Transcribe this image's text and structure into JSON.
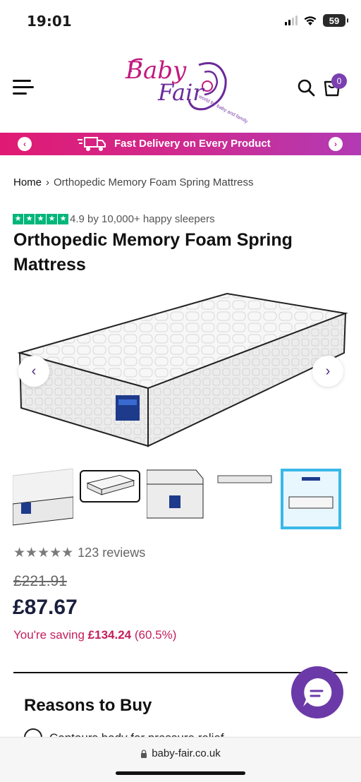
{
  "status_bar": {
    "time": "19:01",
    "battery": "59"
  },
  "header": {
    "logo_line1": "Baby",
    "logo_line2": "Fair",
    "logo_tagline": "a world for baby and family",
    "cart_count": "0"
  },
  "promo": {
    "text": "Fast Delivery on Every Product",
    "prev": "‹",
    "next": "›"
  },
  "breadcrumb": {
    "home": "Home",
    "separator": "›",
    "current": "Orthopedic Memory Foam Spring Mattress"
  },
  "rating_summary": {
    "stars": "★",
    "text": "4.9 by 10,000+ happy sleepers",
    "star_color": "#00b67a"
  },
  "product": {
    "title": "Orthopedic Memory Foam Spring Mattress",
    "reviews_stars": "★★★★★",
    "reviews_text": "123 reviews",
    "old_price": "£221.91",
    "new_price": "£87.67",
    "saving_prefix": "You're saving",
    "saving_amount": "£134.24",
    "saving_percent": "(60.5%)"
  },
  "gallery": {
    "prev": "‹",
    "next": "›",
    "thumb_count": 5
  },
  "reasons": {
    "title": "Reasons to Buy",
    "first_item": "Contours body for pressure relief"
  },
  "browser": {
    "url": "baby-fair.co.uk"
  },
  "colors": {
    "accent_pink": "#e01a73",
    "accent_purple": "#6b3aa8",
    "price_navy": "#1a1f3c",
    "saving_red": "#c21f5c"
  },
  "icons": [
    "menu-icon",
    "search-icon",
    "cart-icon",
    "truck-icon",
    "chat-icon",
    "lock-icon"
  ]
}
